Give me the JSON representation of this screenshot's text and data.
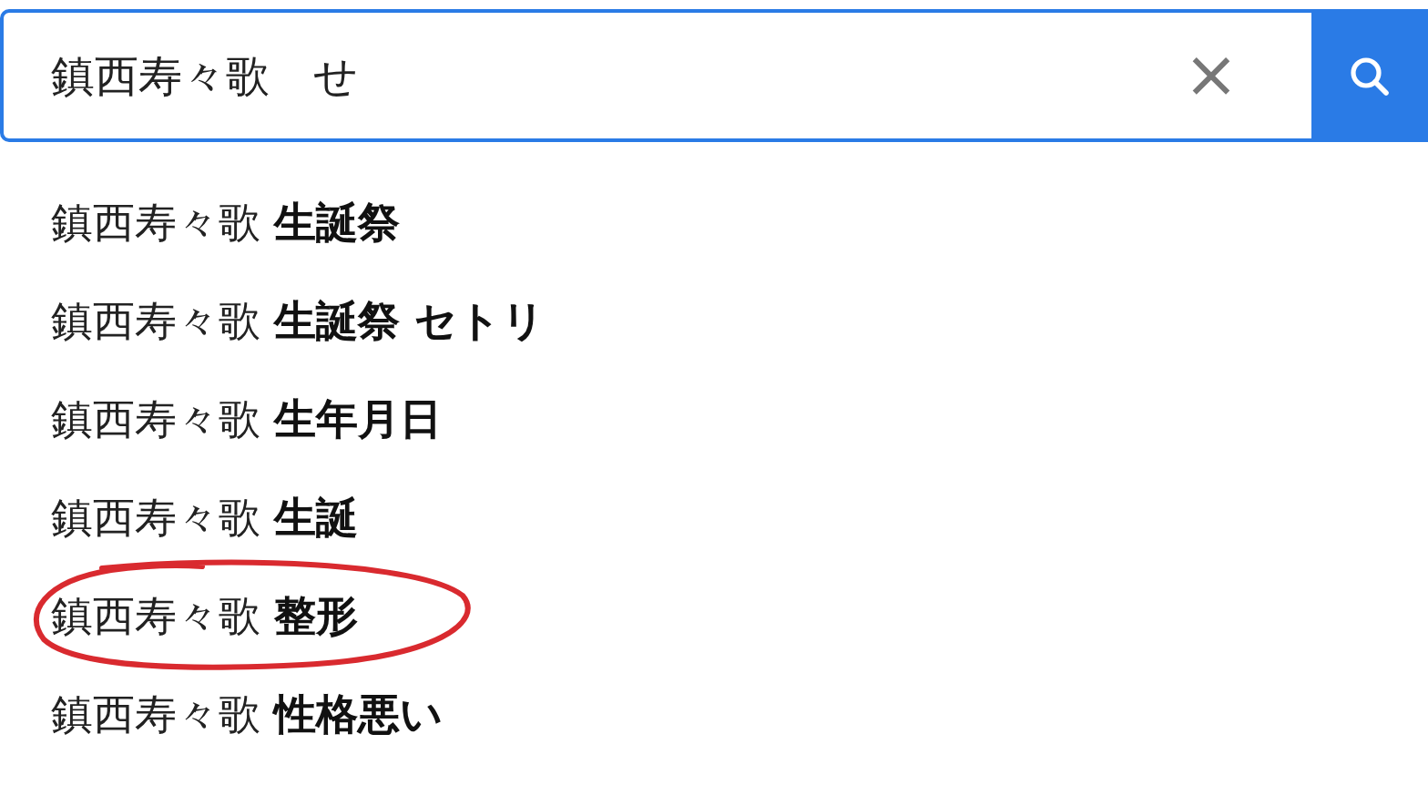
{
  "search": {
    "value": "鎮西寿々歌　せ",
    "clear_icon": "×"
  },
  "suggestions": [
    {
      "text": "鎮西寿々歌 **生誕祭**",
      "circled": false
    },
    {
      "text": "鎮西寿々歌 **生誕祭 セトリ**",
      "circled": false
    },
    {
      "text": "鎮西寿々歌 **生年月日**",
      "circled": false
    },
    {
      "text": "鎮西寿々歌 **生誕**",
      "circled": false
    },
    {
      "text": "鎮西寿々歌 **整形**",
      "circled": true
    },
    {
      "text": "鎮西寿々歌 **性格悪い**",
      "circled": false
    }
  ]
}
